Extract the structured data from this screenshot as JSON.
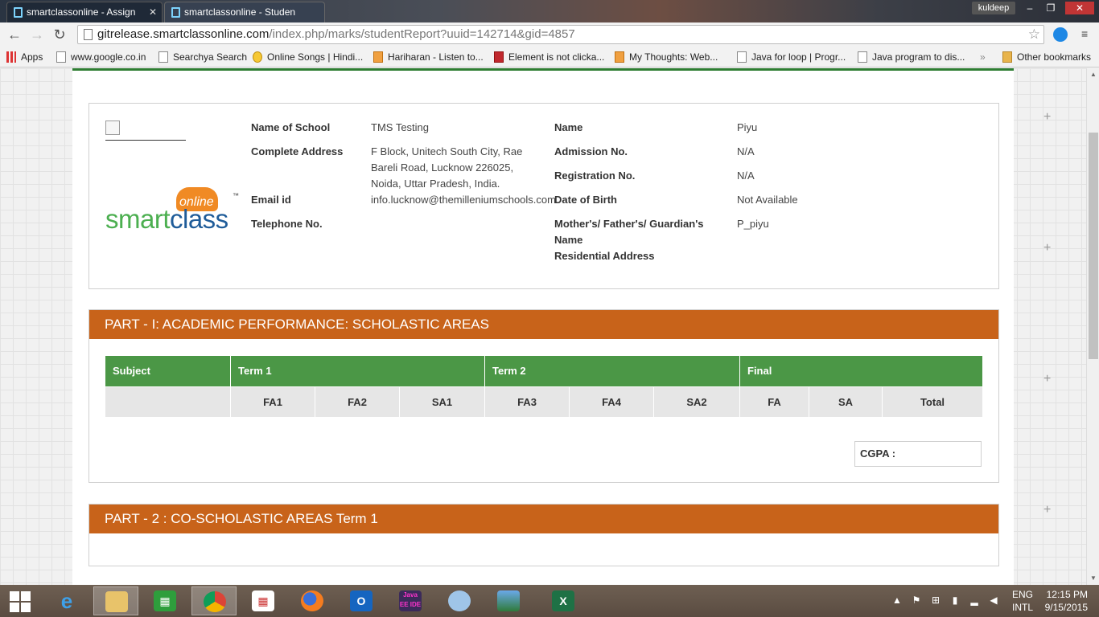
{
  "browser": {
    "tabs": [
      {
        "title": "smartclassonline - Assign"
      },
      {
        "title": "smartclassonline - Studen"
      }
    ],
    "user": "kuldeep",
    "url_host": "gitrelease.smartclassonline.com",
    "url_path": "/index.php/marks/studentReport?uuid=142714&gid=4857",
    "bookmarks": [
      "Apps",
      "www.google.co.in",
      "Searchya Search",
      "Online Songs | Hindi...",
      "Hariharan - Listen to...",
      "Element is not clicka...",
      "My Thoughts: Web...",
      "Java for loop | Progr...",
      "Java program to dis...",
      "»",
      "Other bookmarks"
    ]
  },
  "report": {
    "logo": {
      "online": "online",
      "smart": "smart",
      "class": "class",
      "tm": "™"
    },
    "school_labels": {
      "name": "Name of School",
      "address": "Complete Address",
      "email": "Email id",
      "phone": "Telephone No."
    },
    "school_values": {
      "name": "TMS Testing",
      "address_l1": "F Block, Unitech South City, Rae",
      "address_l2": "Bareli Road, Lucknow 226025,",
      "address_l3": "Noida, Uttar Pradesh, India.",
      "email": "info.lucknow@themilleniumschools.com"
    },
    "student_labels": {
      "name": "Name",
      "admission": "Admission No.",
      "registration": "Registration No.",
      "dob": "Date of Birth",
      "guardian_l1": "Mother's/ Father's/ Guardian's",
      "guardian_l2": "Name",
      "residential": "Residential Address"
    },
    "student_values": {
      "name": "Piyu",
      "admission": "N/A",
      "registration": "N/A",
      "dob": "Not Available",
      "guardian": "P_piyu"
    },
    "part1": {
      "title": "PART - I: ACADEMIC PERFORMANCE: SCHOLASTIC AREAS",
      "headers": [
        "Subject",
        "Term 1",
        "Term 2",
        "Final"
      ],
      "subheaders": [
        "FA1",
        "FA2",
        "SA1",
        "FA3",
        "FA4",
        "SA2",
        "FA",
        "SA",
        "Total"
      ],
      "cgpa_label": "CGPA :"
    },
    "part2": {
      "title": "PART - 2 : CO-SCHOLASTIC AREAS Term 1"
    }
  },
  "taskbar": {
    "apps": [
      "IE",
      "Explorer",
      "Store",
      "Chrome",
      "Apps",
      "Firefox",
      "Outlook",
      "Java EE IDE",
      "Paint",
      "Photos",
      "Excel"
    ],
    "lang": "ENG",
    "layout": "INTL",
    "time": "12:15 PM",
    "date": "9/15/2015"
  },
  "colors": {
    "section_orange": "#c8631a",
    "table_green": "#4b9746",
    "logo_green": "#4caf50",
    "logo_blue": "#1f5c99",
    "logo_orange": "#f08a24"
  }
}
